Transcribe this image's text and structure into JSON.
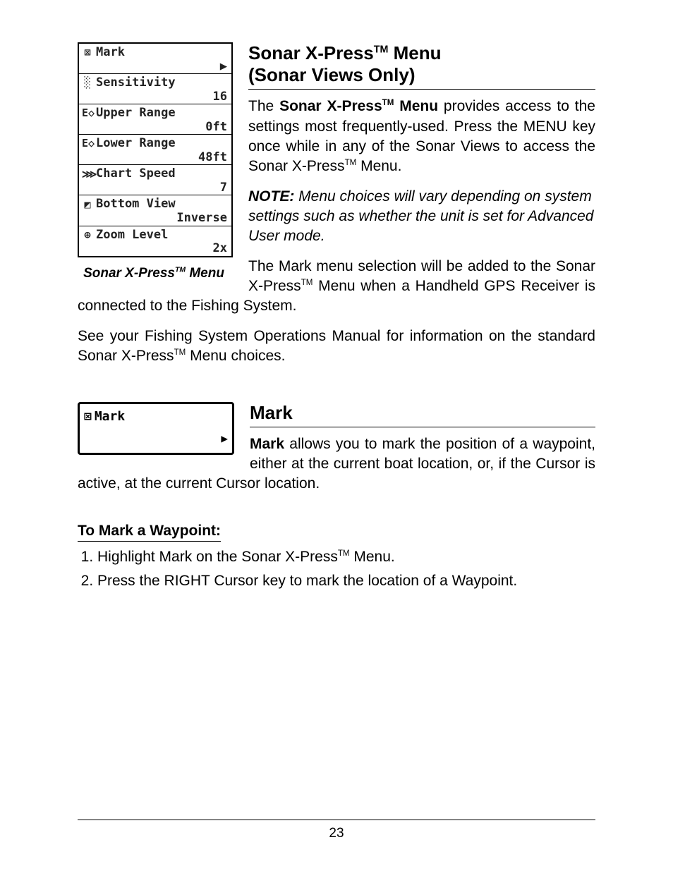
{
  "page_number": "23",
  "menu": {
    "caption_prefix": "Sonar X-Press",
    "caption_suffix": " Menu",
    "items": [
      {
        "icon_name": "mark-icon",
        "icon": "⊠",
        "label": "Mark",
        "value": "▶"
      },
      {
        "icon_name": "sensitivity-icon",
        "icon": "░",
        "label": "Sensitivity",
        "value": "16"
      },
      {
        "icon_name": "upper-range-icon",
        "icon": "E◇",
        "label": "Upper Range",
        "value": "0ft"
      },
      {
        "icon_name": "lower-range-icon",
        "icon": "E◇",
        "label": "Lower Range",
        "value": "48ft"
      },
      {
        "icon_name": "chart-speed-icon",
        "icon": "⋙",
        "label": "Chart Speed",
        "value": "7"
      },
      {
        "icon_name": "bottom-view-icon",
        "icon": "◩",
        "label": "Bottom View",
        "value": "Inverse"
      },
      {
        "icon_name": "zoom-level-icon",
        "icon": "⊕",
        "label": "Zoom Level",
        "value": "2x"
      }
    ]
  },
  "section1": {
    "title_l1_prefix": "Sonar X-Press",
    "title_l1_suffix": " Menu",
    "title_l2": "(Sonar Views Only)",
    "p1_lead_prefix": "Sonar X-Press",
    "p1_lead_suffix": " Menu",
    "p1_prefix": "The ",
    "p1_rest_a": " provides access to the settings most frequently-used. Press the MENU key once while in any of the Sonar Views to access the Sonar X-Press",
    "p1_rest_b": " Menu.",
    "note_lead": "NOTE:",
    "note_text": " Menu choices will vary depending on system settings such as whether the unit is set for Advanced User mode.",
    "p2_a": "The Mark menu selection will be added to the Sonar X-Press",
    "p2_b": " Menu when a Handheld GPS Receiver is connected to the Fishing System.",
    "p3_a": "See your Fishing System Operations Manual for information on the standard Sonar X-Press",
    "p3_b": " Menu choices."
  },
  "mark_figure": {
    "icon": "⊠",
    "label": "Mark",
    "arrow": "▶"
  },
  "section2": {
    "title": "Mark",
    "p1_lead": "Mark",
    "p1_rest": " allows you to mark the position of a waypoint, either at the current boat location, or, if the Cursor is active, at the current Cursor location.",
    "subhead": "To Mark a Waypoint:",
    "steps": [
      {
        "a": "Highlight Mark on the Sonar X-Press",
        "b": " Menu."
      },
      {
        "a": "Press the RIGHT Cursor key to mark the location of a Waypoint.",
        "b": ""
      }
    ]
  }
}
